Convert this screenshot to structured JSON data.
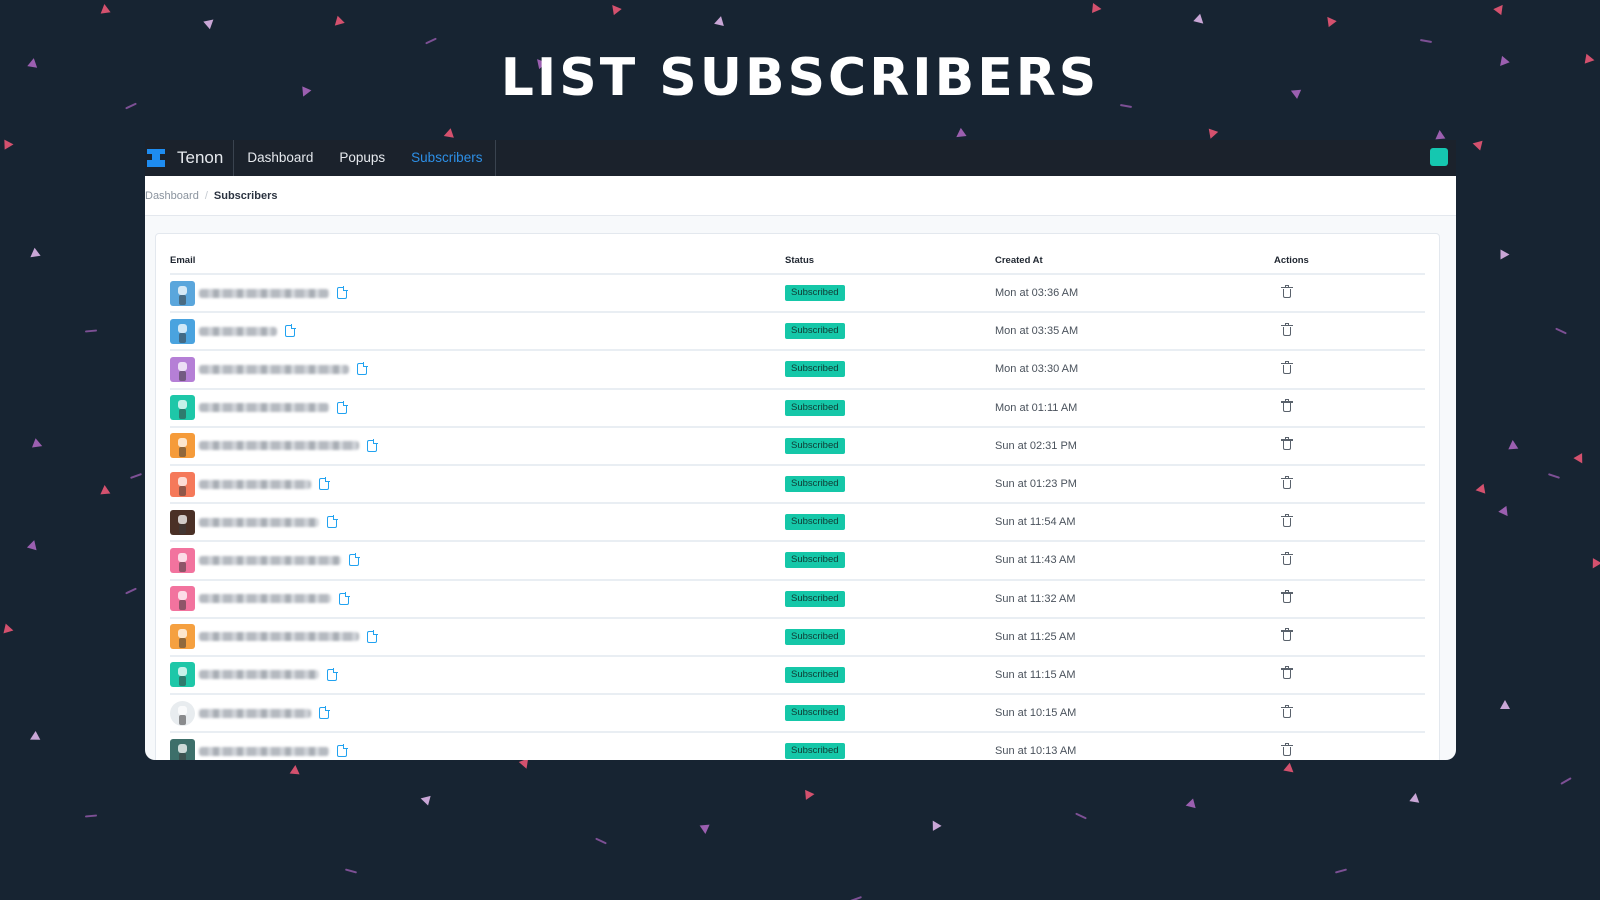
{
  "hero": {
    "title": "LIST SUBSCRIBERS"
  },
  "navbar": {
    "brand": "Tenon",
    "items": [
      {
        "label": "Dashboard",
        "active": false
      },
      {
        "label": "Popups",
        "active": false
      },
      {
        "label": "Subscribers",
        "active": true
      }
    ],
    "accent_color": "#2d8fe6",
    "badge_color": "#15c7b0"
  },
  "breadcrumb": {
    "items": [
      "Dashboard",
      "Subscribers"
    ]
  },
  "table": {
    "headers": {
      "email": "Email",
      "status": "Status",
      "created_at": "Created At",
      "actions": "Actions"
    },
    "rows": [
      {
        "email": "[blurred]",
        "avatar_color": "#5aa6dc",
        "status": "Subscribed",
        "created_at": "Mon at 03:36 AM"
      },
      {
        "email": "[blurred]",
        "avatar_color": "#4aa3df",
        "status": "Subscribed",
        "created_at": "Mon at 03:35 AM"
      },
      {
        "email": "[blurred]",
        "avatar_color": "#b57fd6",
        "status": "Subscribed",
        "created_at": "Mon at 03:30 AM"
      },
      {
        "email": "[blurred]",
        "avatar_color": "#1ec7a8",
        "status": "Subscribed",
        "created_at": "Mon at 01:11 AM"
      },
      {
        "email": "[blurred]",
        "avatar_color": "#f59b3a",
        "status": "Subscribed",
        "created_at": "Sun at 02:31 PM"
      },
      {
        "email": "[blurred]",
        "avatar_color": "#f5795a",
        "status": "Subscribed",
        "created_at": "Sun at 01:23 PM"
      },
      {
        "email": "[blurred]",
        "avatar_color": "#4a3026",
        "status": "Subscribed",
        "created_at": "Sun at 11:54 AM"
      },
      {
        "email": "[blurred]",
        "avatar_color": "#f2739e",
        "status": "Subscribed",
        "created_at": "Sun at 11:43 AM"
      },
      {
        "email": "[blurred]",
        "avatar_color": "#f2739e",
        "status": "Subscribed",
        "created_at": "Sun at 11:32 AM"
      },
      {
        "email": "[blurred]",
        "avatar_color": "#f5a040",
        "status": "Subscribed",
        "created_at": "Sun at 11:25 AM"
      },
      {
        "email": "[blurred]",
        "avatar_color": "#1ec7a8",
        "status": "Subscribed",
        "created_at": "Sun at 11:15 AM"
      },
      {
        "email": "[blurred]",
        "avatar_color": "#e8ecef",
        "status": "Subscribed",
        "created_at": "Sun at 10:15 AM"
      },
      {
        "email": "[blurred]",
        "avatar_color": "#3d6f6a",
        "status": "Subscribed",
        "created_at": "Sun at 10:13 AM"
      }
    ],
    "status_color": "#15c7a8"
  },
  "icons": {
    "logo": "tenon-logo-icon",
    "copy": "copy-icon",
    "delete": "trash-icon",
    "chat": "chat-icon"
  }
}
